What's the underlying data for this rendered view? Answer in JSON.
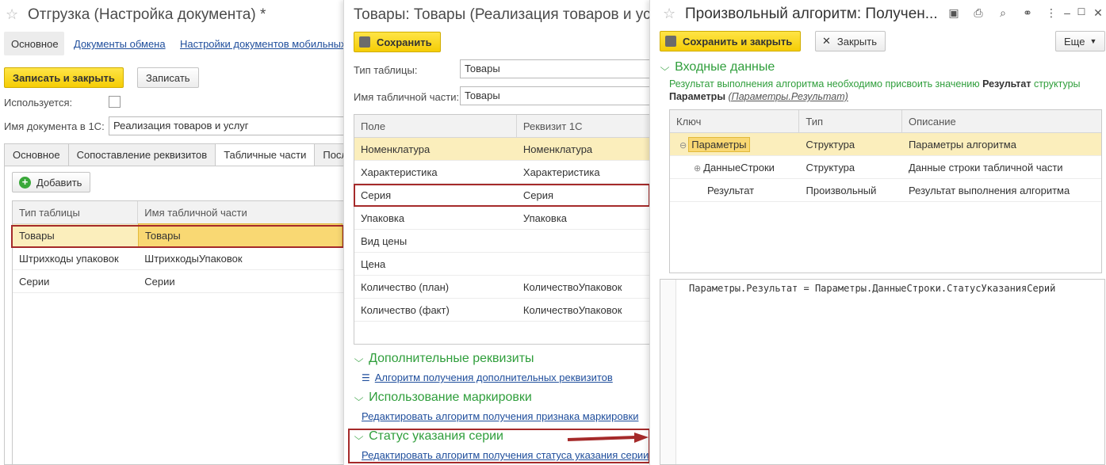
{
  "win1": {
    "title": "Отгрузка (Настройка документа) *",
    "nav": [
      "Основное",
      "Документы обмена",
      "Настройки документов мобильных"
    ],
    "save_close": "Записать и закрыть",
    "save": "Записать",
    "used_label": "Используется:",
    "doc_name_label": "Имя документа в 1С:",
    "doc_name_value": "Реализация товаров и услуг",
    "tabs": [
      "Основное",
      "Сопоставление реквизитов",
      "Табличные части",
      "После"
    ],
    "add_button": "Добавить",
    "columns": [
      "Тип таблицы",
      "Имя табличной части"
    ],
    "rows": [
      [
        "Товары",
        "Товары"
      ],
      [
        "Штрихкоды упаковок",
        "ШтрихкодыУпаковок"
      ],
      [
        "Серии",
        "Серии"
      ]
    ]
  },
  "win2": {
    "title": "Товары: Товары (Реализация товаров и усл",
    "save": "Сохранить",
    "table_type_label": "Тип таблицы:",
    "table_type_value": "Товары",
    "table_part_label": "Имя табличной части:",
    "table_part_value": "Товары",
    "columns": [
      "Поле",
      "Реквизит 1С"
    ],
    "rows": [
      [
        "Номенклатура",
        "Номенклатура"
      ],
      [
        "Характеристика",
        "Характеристика"
      ],
      [
        "Серия",
        "Серия"
      ],
      [
        "Упаковка",
        "Упаковка"
      ],
      [
        "Вид цены",
        ""
      ],
      [
        "Цена",
        ""
      ],
      [
        "Количество (план)",
        "КоличествоУпаковок"
      ],
      [
        "Количество (факт)",
        "КоличествоУпаковок"
      ]
    ],
    "sections": [
      {
        "title": "Дополнительные реквизиты",
        "link": "Алгоритм получения дополнительных реквизитов"
      },
      {
        "title": "Использование маркировки",
        "link": "Редактировать алгоритм получения признака маркировки"
      },
      {
        "title": "Статус указания серии",
        "link": "Редактировать алгоритм получения статуса указания серии"
      }
    ]
  },
  "win3": {
    "title": "Произвольный алгоритм: Получен...",
    "save_close": "Сохранить и закрыть",
    "close": "Закрыть",
    "more": "Еще",
    "section_title": "Входные данные",
    "hint_prefix": "Результат выполнения алгоритма необходимо присвоить значению ",
    "hint_bold1": "Результат",
    "hint_mid": " структуры",
    "hint_bold2": "Параметры",
    "hint_paren": "(Параметры.Результат)",
    "columns": [
      "Ключ",
      "Тип",
      "Описание"
    ],
    "rows": [
      [
        "Параметры",
        "Структура",
        "Параметры алгоритма"
      ],
      [
        "ДанныеСтроки",
        "Структура",
        "Данные строки табличной части"
      ],
      [
        "Результат",
        "Произвольный",
        "Результат выполнения алгоритма"
      ]
    ],
    "code": "Параметры.Результат = Параметры.ДанныеСтроки.СтатусУказанияСерий"
  }
}
